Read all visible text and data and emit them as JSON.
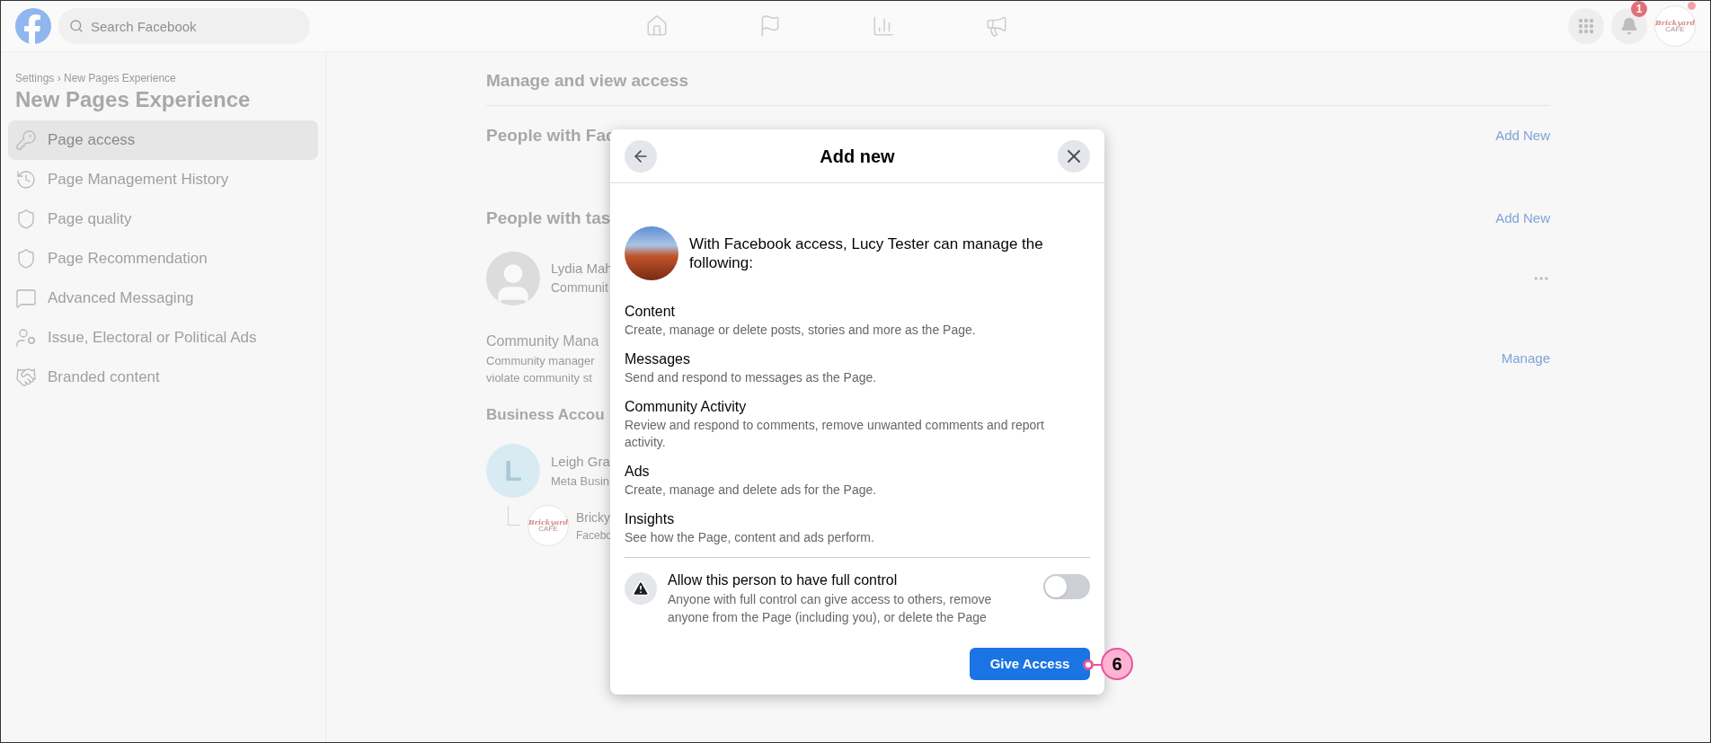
{
  "top_bar": {
    "search": {
      "placeholder": "Search Facebook"
    },
    "notification_count": "1",
    "page_logo": {
      "line_1": "Brickyard",
      "line_2": "CAFE"
    }
  },
  "sidebar": {
    "breadcrumb": "Settings › New Pages Experience",
    "title": "New Pages Experience",
    "items": [
      {
        "label": "Page access",
        "selected": true
      },
      {
        "label": "Page Management History",
        "selected": false
      },
      {
        "label": "Page quality",
        "selected": false
      },
      {
        "label": "Page Recommendation",
        "selected": false
      },
      {
        "label": "Advanced Messaging",
        "selected": false
      },
      {
        "label": "Issue, Electoral or Political Ads",
        "selected": false
      },
      {
        "label": "Branded content",
        "selected": false
      }
    ]
  },
  "main": {
    "heading": "Manage and view access",
    "section_1": {
      "title": "People with Fac",
      "action": "Add New"
    },
    "section_2": {
      "title": "People with tas",
      "action": "Add New",
      "person": {
        "name": "Lydia Mah",
        "role": "Communit"
      }
    },
    "community": {
      "title": "Community Mana",
      "description_line_1": "Community manager",
      "description_line_2": "violate community st",
      "action": "Manage"
    },
    "business": {
      "title": "Business Accou",
      "person": {
        "initial": "L",
        "name": "Leigh Gra",
        "role": "Meta Busin"
      },
      "page": {
        "logo_line_1": "Brickyard",
        "logo_line_2": "CAFE",
        "name": "Bricky",
        "role": "Facebo"
      }
    }
  },
  "dialog": {
    "title": "Add new",
    "intro": "With Facebook access, Lucy Tester can manage the following:",
    "permissions": [
      {
        "title": "Content",
        "description": "Create, manage or delete posts, stories and more as the Page."
      },
      {
        "title": "Messages",
        "description": "Send and respond to messages as the Page."
      },
      {
        "title": "Community Activity",
        "description": "Review and respond to comments, remove unwanted comments and report activity."
      },
      {
        "title": "Ads",
        "description": "Create, manage and delete ads for the Page."
      },
      {
        "title": "Insights",
        "description": "See how the Page, content and ads perform."
      }
    ],
    "full_control": {
      "title": "Allow this person to have full control",
      "description": "Anyone with full control can give access to others, remove anyone from the Page (including you), or delete the Page",
      "on": false
    },
    "button": "Give Access",
    "callout": "6"
  }
}
